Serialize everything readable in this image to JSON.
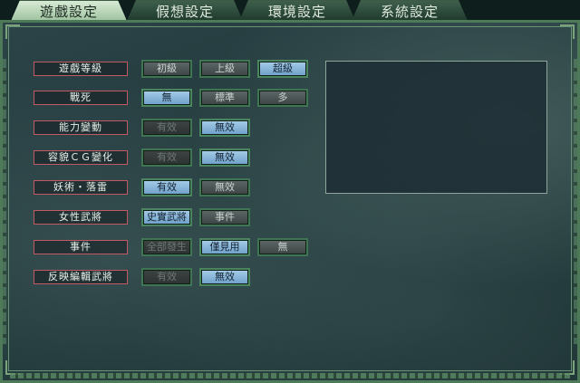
{
  "tabs": [
    {
      "label": "遊戲設定",
      "active": true
    },
    {
      "label": "假想設定",
      "active": false
    },
    {
      "label": "環境設定",
      "active": false
    },
    {
      "label": "系統設定",
      "active": false
    }
  ],
  "rows": [
    {
      "label": "遊戲等級",
      "options": [
        {
          "label": "初級",
          "state": "off"
        },
        {
          "label": "上級",
          "state": "off"
        },
        {
          "label": "超級",
          "state": "on"
        }
      ]
    },
    {
      "label": "戰死",
      "options": [
        {
          "label": "無",
          "state": "on"
        },
        {
          "label": "標準",
          "state": "off"
        },
        {
          "label": "多",
          "state": "off"
        }
      ]
    },
    {
      "label": "能力變動",
      "options": [
        {
          "label": "有效",
          "state": "dis"
        },
        {
          "label": "無效",
          "state": "on"
        }
      ]
    },
    {
      "label": "容貌ＣＧ變化",
      "options": [
        {
          "label": "有效",
          "state": "dis"
        },
        {
          "label": "無效",
          "state": "on"
        }
      ]
    },
    {
      "label": "妖術・落雷",
      "options": [
        {
          "label": "有效",
          "state": "on"
        },
        {
          "label": "無效",
          "state": "off"
        }
      ]
    },
    {
      "label": "女性武將",
      "options": [
        {
          "label": "史實武將",
          "state": "on"
        },
        {
          "label": "事件",
          "state": "off"
        }
      ]
    },
    {
      "label": "事件",
      "options": [
        {
          "label": "全部發生",
          "state": "dis"
        },
        {
          "label": "僅見用",
          "state": "on"
        },
        {
          "label": "無",
          "state": "off"
        }
      ]
    },
    {
      "label": "反映編輯武將",
      "options": [
        {
          "label": "有效",
          "state": "dis"
        },
        {
          "label": "無效",
          "state": "on"
        }
      ]
    }
  ]
}
